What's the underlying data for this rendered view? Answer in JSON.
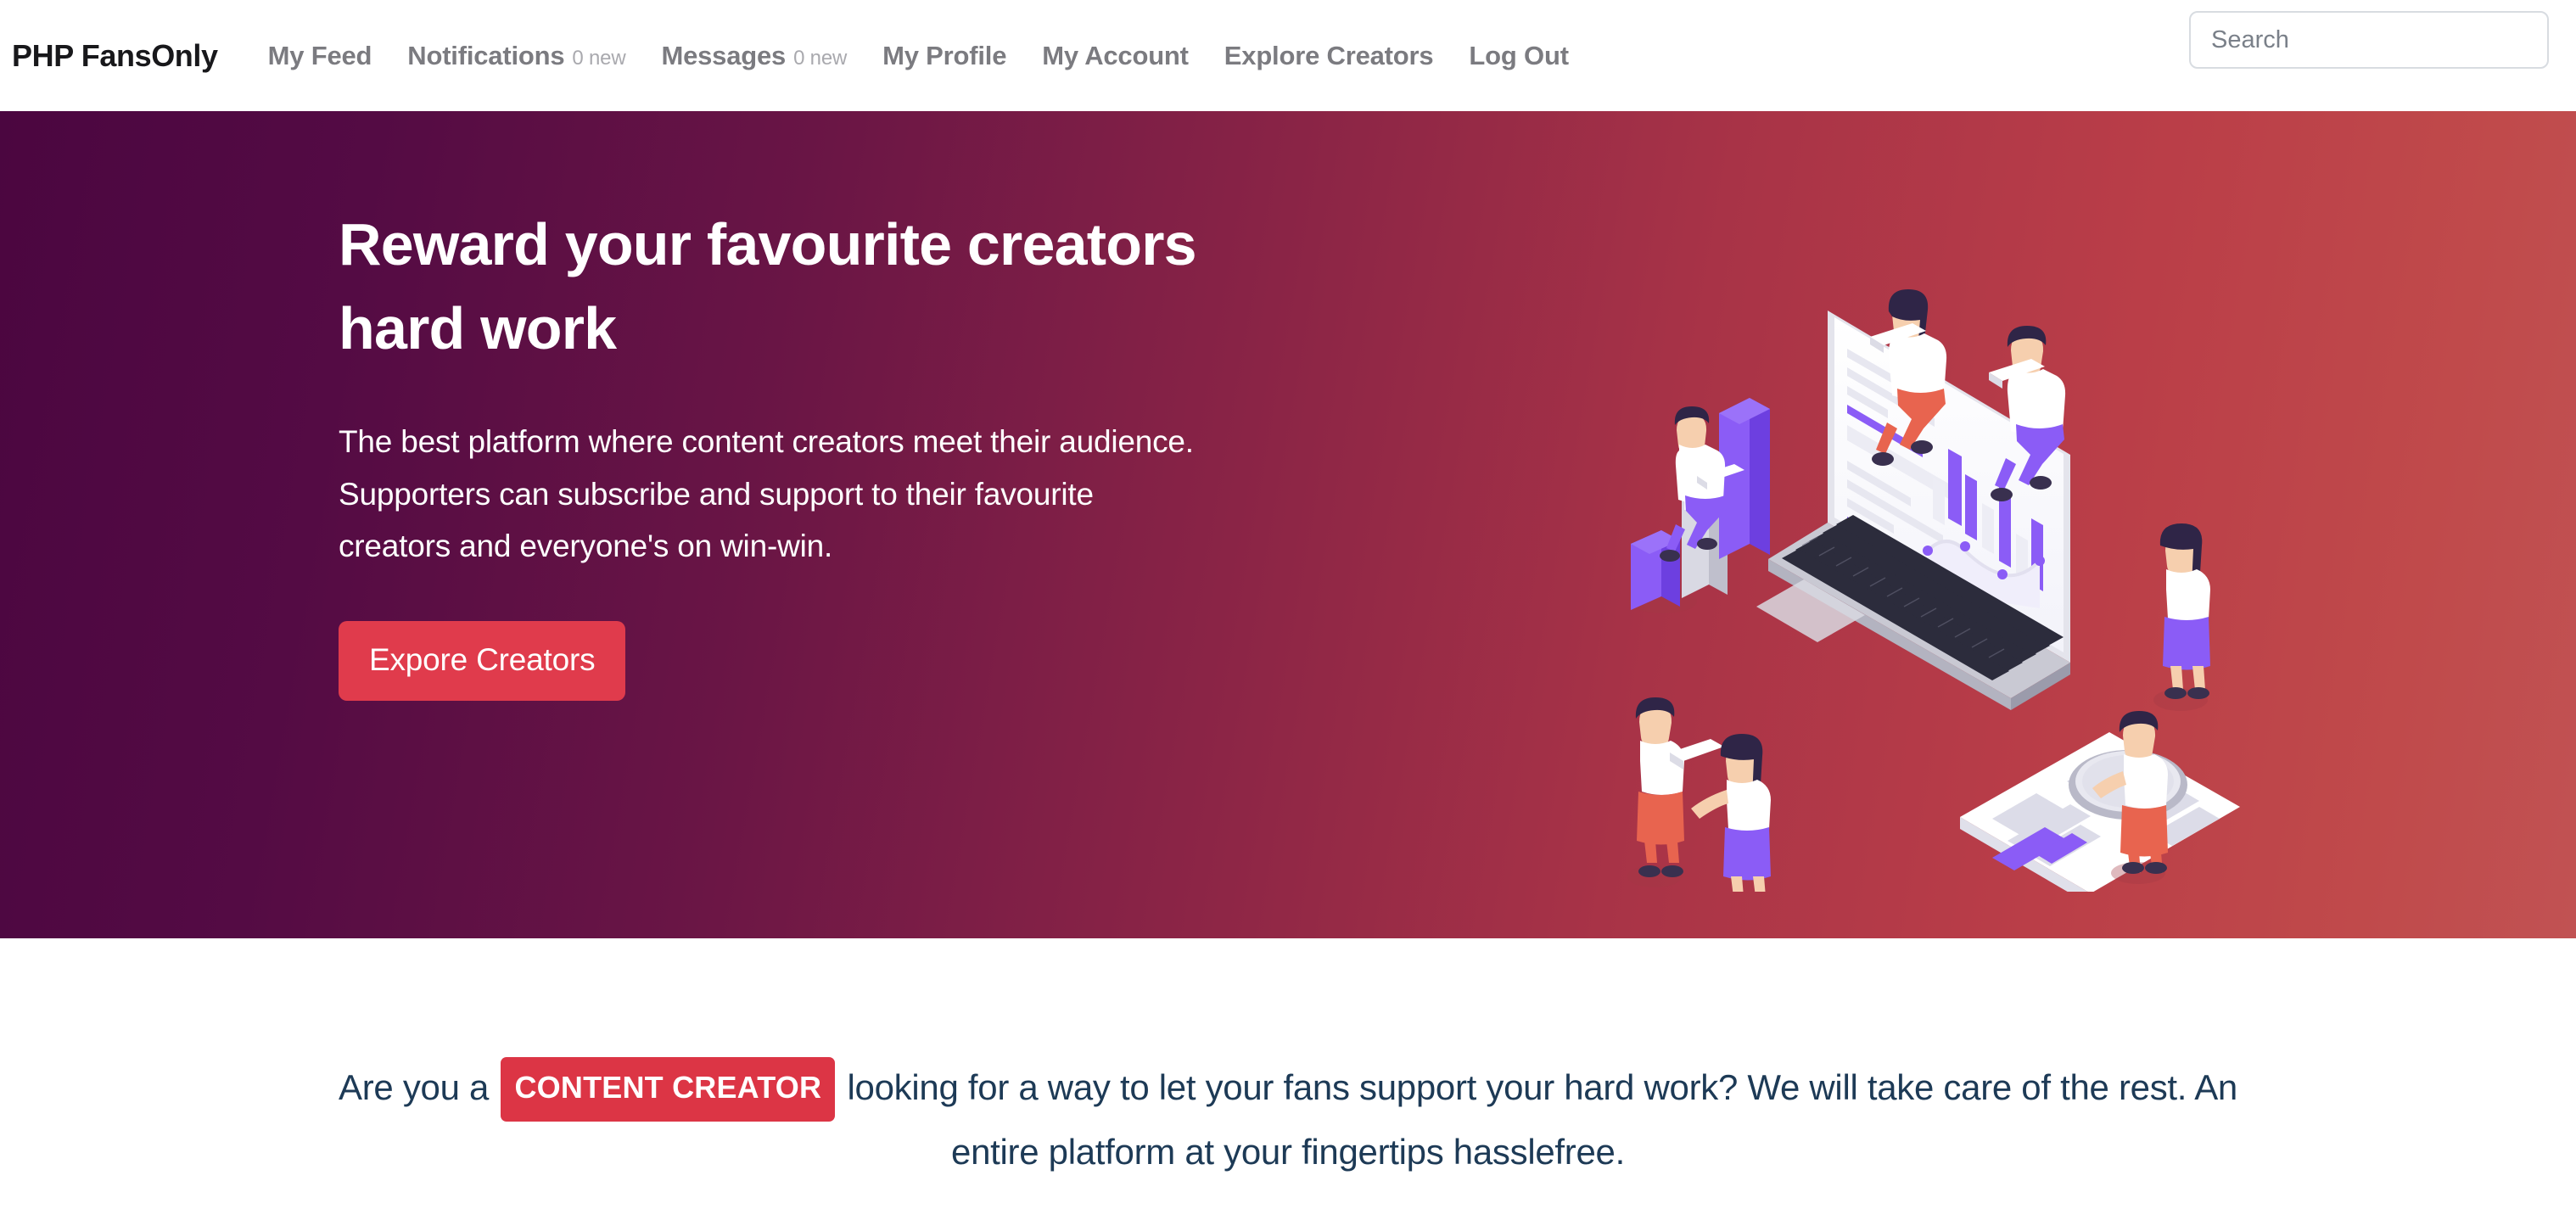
{
  "navbar": {
    "brand": "PHP FansOnly",
    "items": [
      {
        "label": "My Feed",
        "sub": "",
        "name": "my-feed"
      },
      {
        "label": "Notifications",
        "sub": "0 new",
        "name": "notifications"
      },
      {
        "label": "Messages",
        "sub": "0 new",
        "name": "messages"
      },
      {
        "label": "My Profile",
        "sub": "",
        "name": "my-profile"
      },
      {
        "label": "My Account",
        "sub": "",
        "name": "my-account"
      },
      {
        "label": "Explore Creators",
        "sub": "",
        "name": "explore-creators"
      },
      {
        "label": "Log Out",
        "sub": "",
        "name": "log-out"
      }
    ],
    "search": {
      "placeholder": "Search",
      "value": ""
    }
  },
  "hero": {
    "title_line1": "Reward your favourite creators",
    "title_line2": "hard work",
    "paragraph": "The best platform where content creators meet their audience. Supporters can subscribe and support to their favourite creators and everyone's on win-win.",
    "cta_label": "Expore Creators",
    "gradient_start": "#4b0640",
    "gradient_end": "#c15253",
    "cta_color": "#e03b4c",
    "illustration": "isometric-laptop-analytics-people"
  },
  "promo": {
    "text_before": "Are you a",
    "badge": "CONTENT CREATOR",
    "text_after": "looking for a way to let your fans support your hard work? We will take care of the rest. An entire platform at your fingertips hasslefree.",
    "badge_color": "#dc3545",
    "text_color": "#1d3a56"
  }
}
